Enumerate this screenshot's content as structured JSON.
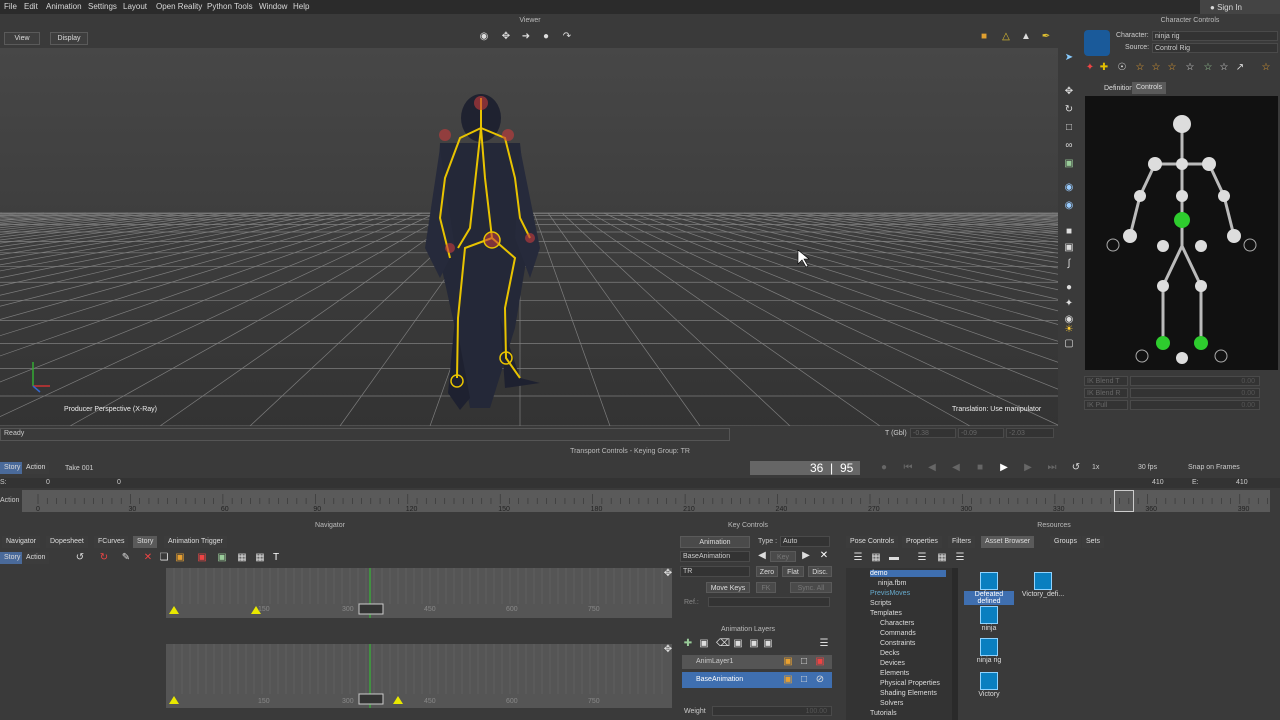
{
  "menu": [
    "File",
    "Edit",
    "Animation",
    "Settings",
    "Layout",
    "Open Reality",
    "Python Tools",
    "Window",
    "Help"
  ],
  "signin": "Sign In",
  "viewer": {
    "title": "Viewer",
    "view_label": "View",
    "display_label": "Display",
    "camera_label": "Producer Perspective (X-Ray)",
    "manip_label": "Translation: Use manipulator",
    "status": "Ready",
    "t_label": "T (Gbl)",
    "t_x": "-0.38",
    "t_y": "-0.09",
    "t_z": "-2.03"
  },
  "char_controls": {
    "title": "Character Controls",
    "character_label": "Character:",
    "character_value": "ninja rig",
    "source_label": "Source:",
    "source_value": "Control Rig",
    "tab_definition": "Definition",
    "tab_controls": "Controls",
    "ik_blend_t": "IK Blend T",
    "ik_blend_r": "IK Blend R",
    "ik_pull": "IK Pull",
    "ik_val": "0.00"
  },
  "transport": {
    "title": "Transport Controls - Keying Group: TR",
    "story_label": "Story",
    "action_label": "Action",
    "take": "Take 001",
    "frame_current": "36",
    "frame_end": "95",
    "speed": "1x",
    "fps": "30 fps",
    "snap": "Snap on Frames",
    "s_label": "S:",
    "s_value": "0",
    "start_value": "0",
    "e_label": "E:",
    "e_value": "410",
    "end_value": "410",
    "action_row": "Action",
    "ticks": [
      "0",
      "30",
      "60",
      "90",
      "120",
      "150",
      "180",
      "210",
      "240",
      "270",
      "300",
      "330",
      "360",
      "390"
    ]
  },
  "navigator": {
    "title": "Navigator",
    "tabs": [
      "Navigator",
      "Dopesheet",
      "FCurves",
      "Story",
      "Animation Trigger"
    ],
    "story_label": "Story",
    "action_label": "Action",
    "ticks1": [
      "150",
      "300",
      "450",
      "600",
      "750"
    ],
    "ticks2": [
      "150",
      "300",
      "450",
      "600",
      "750"
    ]
  },
  "key_controls": {
    "title": "Key Controls",
    "animation": "Animation",
    "type_label": "Type :",
    "type_value": "Auto",
    "base_animation": "BaseAnimation",
    "key_label": "Key",
    "tr_value": "TR",
    "zero": "Zero",
    "flat": "Flat",
    "disc": "Disc.",
    "move_keys": "Move Keys",
    "fk": "FK",
    "sync": "Sync. All",
    "ref_label": "Ref.:",
    "layers_title": "Animation Layers",
    "layer1": "AnimLayer1",
    "layer2": "BaseAnimation",
    "weight_label": "Weight",
    "weight_value": "100.00"
  },
  "resources": {
    "title": "Resources",
    "tabs": [
      "Pose Controls",
      "Properties",
      "Filters",
      "Asset Browser",
      "Groups",
      "Sets"
    ],
    "tree": [
      "demo",
      "ninja.fbm",
      "PrevisMoves",
      "Scripts",
      "Templates",
      "Characters",
      "Commands",
      "Constraints",
      "Decks",
      "Devices",
      "Elements",
      "Physical Properties",
      "Shading Elements",
      "Solvers",
      "Tutorials"
    ],
    "assets": [
      "Defeated defined",
      "Victory_defi...",
      "ninja",
      "ninja rig",
      "Victory"
    ]
  },
  "colors": {
    "accent": "#3f6fb0",
    "bone": "#e8c300",
    "effector_green": "#2ecc2e",
    "asset_blue": "#0a7fc0"
  }
}
